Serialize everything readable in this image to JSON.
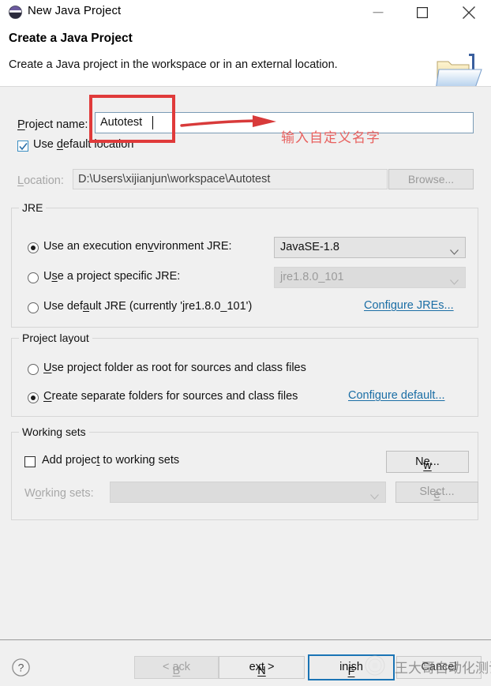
{
  "window": {
    "title": "New Java Project",
    "icon": "eclipse-icon",
    "controls": {
      "minimize": "minimize-icon",
      "maximize": "maximize-icon",
      "close": "close-icon"
    }
  },
  "header": {
    "title": "Create a Java Project",
    "description": "Create a Java project in the workspace or in an external location.",
    "icon": "java-folder-icon"
  },
  "project": {
    "name_label": "Project name:",
    "name_value": "Autotest",
    "use_default_location_label": "Use default location",
    "use_default_location_checked": true,
    "location_label": "Location:",
    "location_value": "D:\\Users\\xijianjun\\workspace\\Autotest",
    "browse_label": "Browse..."
  },
  "jre": {
    "group_title": "JRE",
    "options": [
      {
        "label": "Use an execution environment JRE:",
        "selected": true
      },
      {
        "label": "Use a project specific JRE:",
        "selected": false
      },
      {
        "label": "Use default JRE (currently 'jre1.8.0_101')",
        "selected": false
      }
    ],
    "execution_environment_value": "JavaSE-1.8",
    "project_specific_value": "jre1.8.0_101",
    "configure_link": "Configure JREs..."
  },
  "project_layout": {
    "group_title": "Project layout",
    "options": [
      {
        "label": "Use project folder as root for sources and class files",
        "selected": false
      },
      {
        "label": "Create separate folders for sources and class files",
        "selected": true
      }
    ],
    "configure_link": "Configure default..."
  },
  "working_sets": {
    "group_title": "Working sets",
    "add_label": "Add project to working sets",
    "add_checked": false,
    "new_label": "New...",
    "sets_label": "Working sets:",
    "sets_value": "",
    "select_label": "Select..."
  },
  "footer": {
    "help_icon": "help-icon",
    "back_label": "< Back",
    "next_label": "Next >",
    "finish_label": "Finish",
    "cancel_label": "Cancel"
  },
  "annotation": {
    "text": "输入自定义名字",
    "color": "#e8615f",
    "box_color": "#e03a3a",
    "arrow_color": "#d83a3a"
  },
  "watermark": {
    "text": "王大哥自动化测试",
    "logo": "wechat-logo-watermark"
  }
}
